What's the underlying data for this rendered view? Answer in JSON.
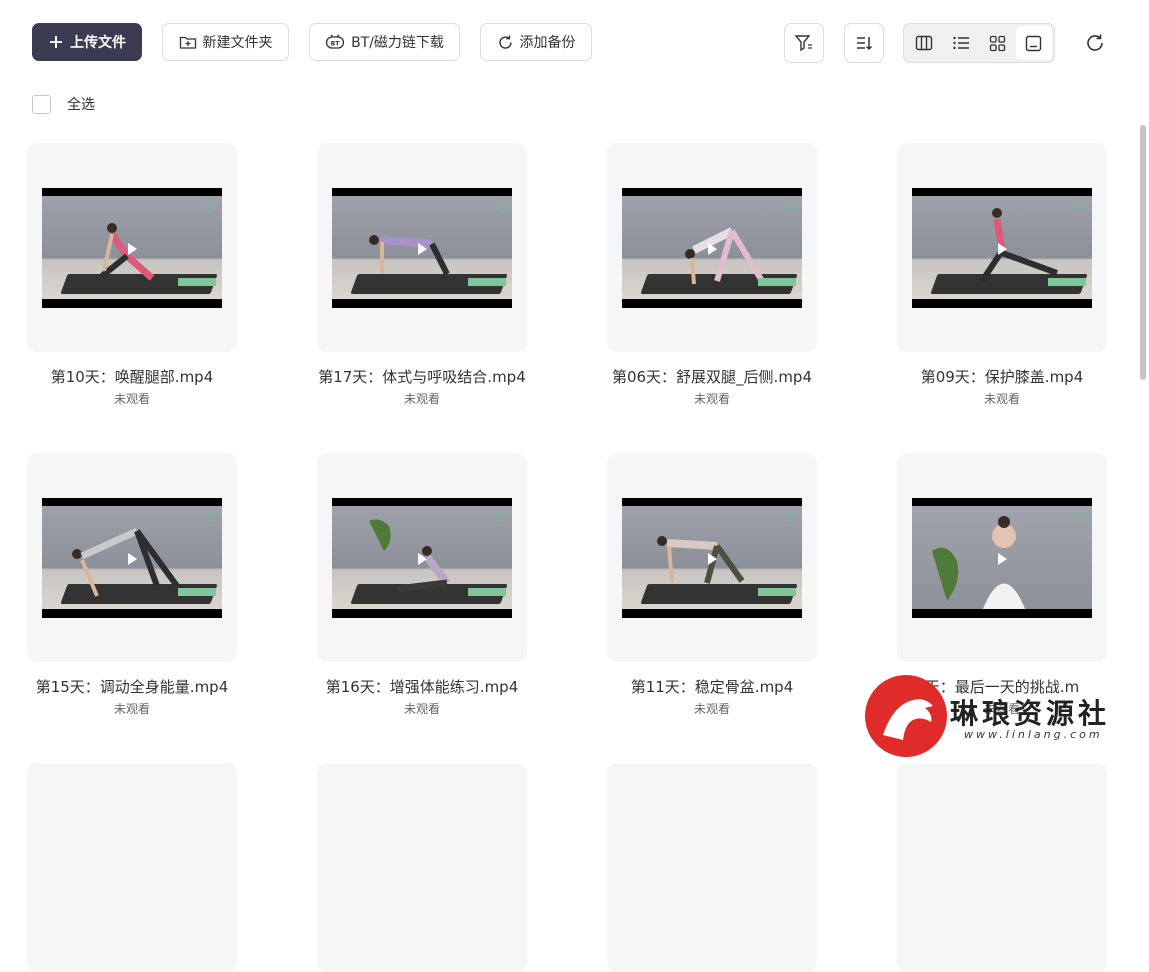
{
  "toolbar": {
    "upload_label": "上传文件",
    "new_folder_label": "新建文件夹",
    "bt_label": "BT/磁力链下载",
    "backup_label": "添加备份"
  },
  "select_all_label": "全选",
  "files": [
    {
      "name": "第10天：唤醒腿部.mp4",
      "status": "未观看"
    },
    {
      "name": "第17天：体式与呼吸结合.mp4",
      "status": "未观看"
    },
    {
      "name": "第06天：舒展双腿_后侧.mp4",
      "status": "未观看"
    },
    {
      "name": "第09天：保护膝盖.mp4",
      "status": "未观看"
    },
    {
      "name": "第15天：调动全身能量.mp4",
      "status": "未观看"
    },
    {
      "name": "第16天：增强体能练习.mp4",
      "status": "未观看"
    },
    {
      "name": "第11天：稳定骨盆.mp4",
      "status": "未观看"
    },
    {
      "name": "天：最后一天的挑战.m",
      "status": "未观看"
    }
  ],
  "watermark": {
    "text": "琳琅资源社",
    "url": "www.linlang.com"
  },
  "colors": {
    "primary": "#3b3c52",
    "accent_red": "#e12a2a"
  }
}
